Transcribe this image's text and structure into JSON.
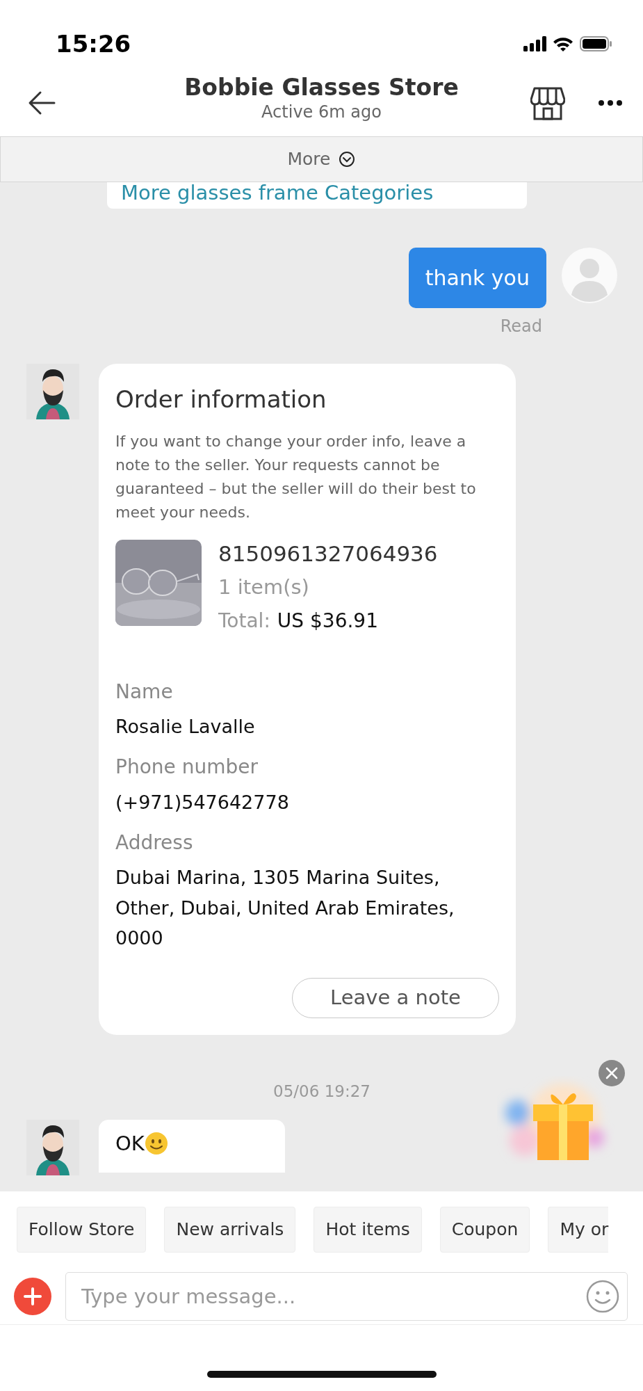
{
  "status_bar": {
    "time": "15:26"
  },
  "header": {
    "title": "Bobbie Glasses Store",
    "subtitle": "Active 6m ago"
  },
  "more_bar": {
    "label": "More"
  },
  "messages": [
    {
      "kind": "link_card",
      "outgoing": false,
      "text": "More glasses frame Categories"
    },
    {
      "kind": "text",
      "outgoing": true,
      "text": "thank you",
      "receipt": "Read"
    },
    {
      "kind": "order",
      "outgoing": false,
      "title": "Order information",
      "note": "If you want to change your order info, leave a note to the seller. Your requests cannot be guaranteed – but the seller will do their best to meet your needs.",
      "order_number": "8150961327064936",
      "items": "1 item(s)",
      "total_label": "Total:",
      "total": "US $36.91",
      "fields": [
        {
          "label": "Name",
          "value": "Rosalie Lavalle"
        },
        {
          "label": "Phone number",
          "value": "(+971)547642778"
        },
        {
          "label": "Address",
          "value": "Dubai Marina, 1305 Marina Suites, Other, Dubai, United Arab Emirates, 0000"
        }
      ],
      "button": "Leave a note"
    },
    {
      "kind": "timestamp",
      "text": "05/06 19:27"
    },
    {
      "kind": "text",
      "outgoing": false,
      "text": "OK",
      "emoji": true
    }
  ],
  "quick_replies": [
    "Follow Store",
    "New arrivals",
    "Hot items",
    "Coupon",
    "My or"
  ],
  "composer": {
    "placeholder": "Type your message..."
  }
}
